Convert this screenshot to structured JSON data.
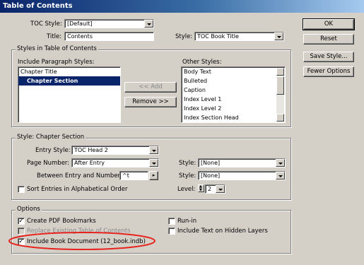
{
  "window": {
    "title": "Table of Contents"
  },
  "toc_style": {
    "label": "TOC Style:",
    "value": "[Default]"
  },
  "title_field": {
    "label": "Title:",
    "value": "Contents"
  },
  "title_style": {
    "label": "Style:",
    "value": "TOC Book Title"
  },
  "buttons": {
    "ok": "OK",
    "reset": "Reset",
    "save_style": "Save Style...",
    "fewer_options": "Fewer Options"
  },
  "styles_group": {
    "title": "Styles in Table of Contents",
    "include_label": "Include Paragraph Styles:",
    "other_label": "Other Styles:",
    "include_items": [
      "Chapter Title",
      "Chapter Section"
    ],
    "selected_index": 1,
    "other_items": [
      "Body Text",
      "Bulleted",
      "Caption",
      "Index Level 1",
      "Index Level 2",
      "Index Section Head"
    ],
    "add_label": "<< Add",
    "remove_label": "Remove >>"
  },
  "style_group": {
    "title": "Style: Chapter Section",
    "entry_style_label": "Entry Style:",
    "entry_style_value": "TOC Head 2",
    "page_number_label": "Page Number:",
    "page_number_value": "After Entry",
    "page_number_style_label": "Style:",
    "page_number_style_value": "[None]",
    "between_label": "Between Entry and Number:",
    "between_value": "^t",
    "between_style_label": "Style:",
    "between_style_value": "[None]",
    "sort_label": "Sort Entries in Alphabetical Order",
    "level_label": "Level:",
    "level_value": "2"
  },
  "options_group": {
    "title": "Options",
    "create_pdf": "Create PDF Bookmarks",
    "replace_existing": "Replace Existing Table of Contents",
    "include_book": "Include Book Document (12_book.indb)",
    "run_in": "Run-in",
    "include_hidden": "Include Text on Hidden Layers"
  },
  "colors": {
    "highlight": "#0a246a",
    "annotation": "#e8231e",
    "face": "#d4d0c8"
  }
}
